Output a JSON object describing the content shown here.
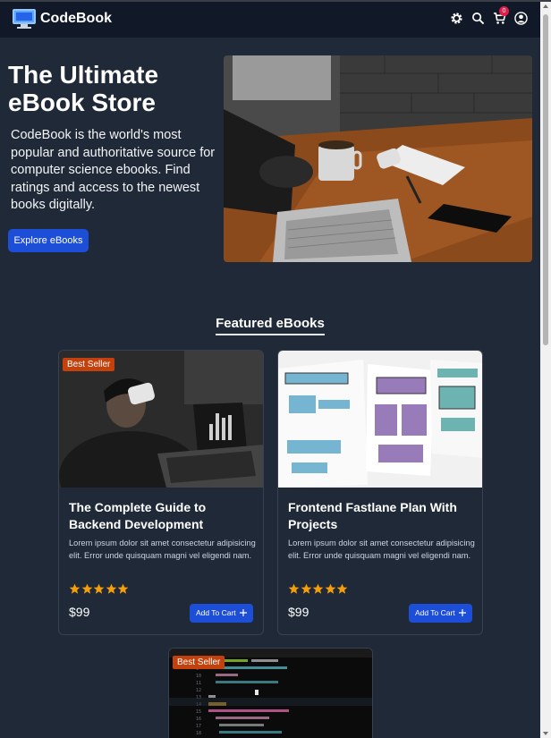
{
  "navbar": {
    "brand": "CodeBook",
    "cart_count": "0"
  },
  "hero": {
    "title": "The Ultimate eBook Store",
    "description": "CodeBook is the world's most popular and authoritative source for computer science ebooks. Find ratings and access to the newest books digitally.",
    "button": "Explore eBooks"
  },
  "featured": {
    "title": "Featured eBooks",
    "cards": [
      {
        "badge": "Best Seller",
        "title": "The Complete Guide to Backend Development",
        "description": "Lorem ipsum dolor sit amet consectetur adipisicing elit. Error unde quisquam magni vel eligendi nam.",
        "rating": 5,
        "price": "$99",
        "cart_label": "Add To Cart"
      },
      {
        "badge": "",
        "title": "Frontend Fastlane Plan With Projects",
        "description": "Lorem ipsum dolor sit amet consectetur adipisicing elit. Error unde quisquam magni vel eligendi nam.",
        "rating": 5,
        "price": "$99",
        "cart_label": "Add To Cart"
      },
      {
        "badge": "Best Seller"
      }
    ]
  },
  "colors": {
    "navbar": "#111827",
    "background": "#1f2937",
    "primary_button": "#1d4ed8",
    "badge": "#c2410c",
    "star": "#f59e0b",
    "cart_badge": "#e11d48"
  },
  "icons": [
    "monitor-logo-icon",
    "gear-icon",
    "search-icon",
    "cart-icon",
    "user-icon",
    "star-icon",
    "plus-icon"
  ]
}
